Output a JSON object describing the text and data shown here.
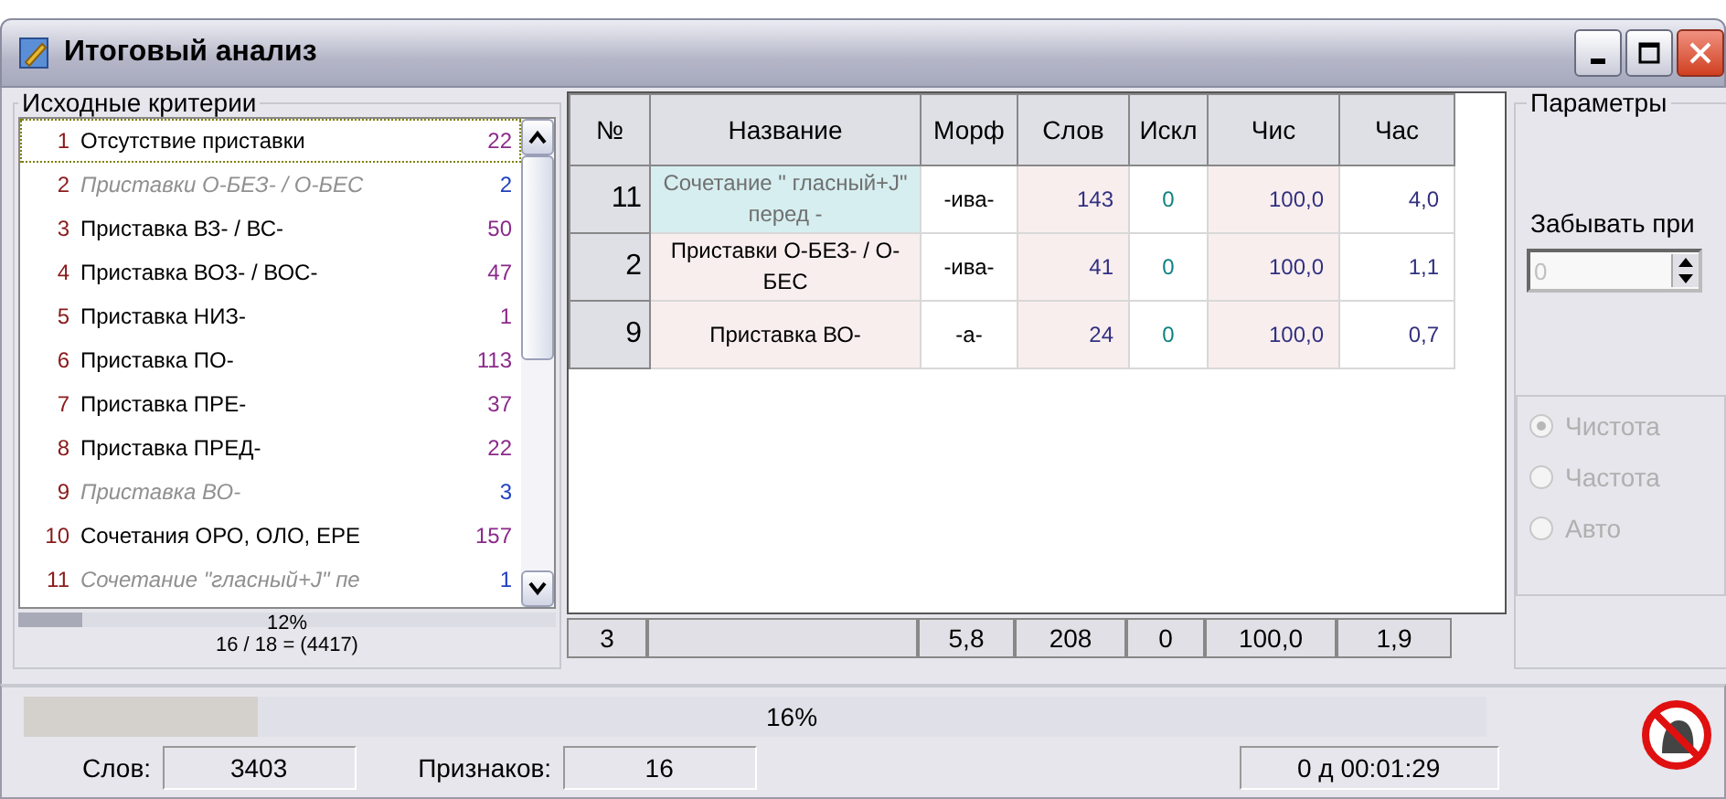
{
  "window": {
    "title": "Итоговый анализ"
  },
  "criteria": {
    "title": "Исходные критерии",
    "items": [
      {
        "number": "1",
        "name": "Отсутствие приставки",
        "count": "22",
        "disabled": false,
        "selected": true
      },
      {
        "number": "2",
        "name": "Приставки О-БЕЗ- / О-БЕС",
        "count": "2",
        "disabled": true,
        "selected": false
      },
      {
        "number": "3",
        "name": "Приставка ВЗ- / ВС-",
        "count": "50",
        "disabled": false,
        "selected": false
      },
      {
        "number": "4",
        "name": "Приставка ВОЗ- / ВОС-",
        "count": "47",
        "disabled": false,
        "selected": false
      },
      {
        "number": "5",
        "name": "Приставка НИЗ-",
        "count": "1",
        "disabled": false,
        "selected": false
      },
      {
        "number": "6",
        "name": "Приставка ПО-",
        "count": "113",
        "disabled": false,
        "selected": false
      },
      {
        "number": "7",
        "name": "Приставка ПРЕ-",
        "count": "37",
        "disabled": false,
        "selected": false
      },
      {
        "number": "8",
        "name": "Приставка ПРЕД-",
        "count": "22",
        "disabled": false,
        "selected": false
      },
      {
        "number": "9",
        "name": "Приставка ВО-",
        "count": "3",
        "disabled": true,
        "selected": false
      },
      {
        "number": "10",
        "name": "Сочетания ОРО, ОЛО, ЕРЕ",
        "count": "157",
        "disabled": false,
        "selected": false
      },
      {
        "number": "11",
        "name": "Сочетание \"гласный+J\" пе",
        "count": "1",
        "disabled": true,
        "selected": false
      }
    ],
    "progress": {
      "label": "12%",
      "level": 0.12
    },
    "summary": "16 / 18 = (4417)"
  },
  "table": {
    "columns": [
      "№",
      "Название",
      "Морф",
      "Слов",
      "Искл",
      "Чис",
      "Час"
    ],
    "rows": [
      {
        "cells": [
          "11",
          "Сочетание \" гласный+J\" перед -",
          "-ива-",
          "143",
          "0",
          "100,0",
          "4,0"
        ],
        "selected": true
      },
      {
        "cells": [
          "2",
          "Приставки О-БЕЗ- / О-БЕС",
          "-ива-",
          "41",
          "0",
          "100,0",
          "1,1"
        ],
        "selected": false
      },
      {
        "cells": [
          "9",
          "Приставка ВО-",
          "-а-",
          "24",
          "0",
          "100,0",
          "0,7"
        ],
        "selected": false
      }
    ],
    "totals": {
      "count": "3",
      "morph": "5,8",
      "words": "208",
      "excluded": "0",
      "purity": "100,0",
      "frequency": "1,9"
    }
  },
  "parameters": {
    "title": "Параметры",
    "forget_label": "Забывать при",
    "forget_value": "0",
    "forget_disabled": true,
    "mode": [
      {
        "label": "Чистота",
        "selected": true,
        "disabled": true
      },
      {
        "label": "Частота",
        "selected": false,
        "disabled": true
      },
      {
        "label": "Авто",
        "selected": false,
        "disabled": true
      }
    ]
  },
  "status": {
    "progress": {
      "label": "16%",
      "level": 0.16
    },
    "words_label": "Слов:",
    "words": "3403",
    "features_label": "Признаков:",
    "features": "16",
    "elapsed": "0 д 00:01:29"
  }
}
